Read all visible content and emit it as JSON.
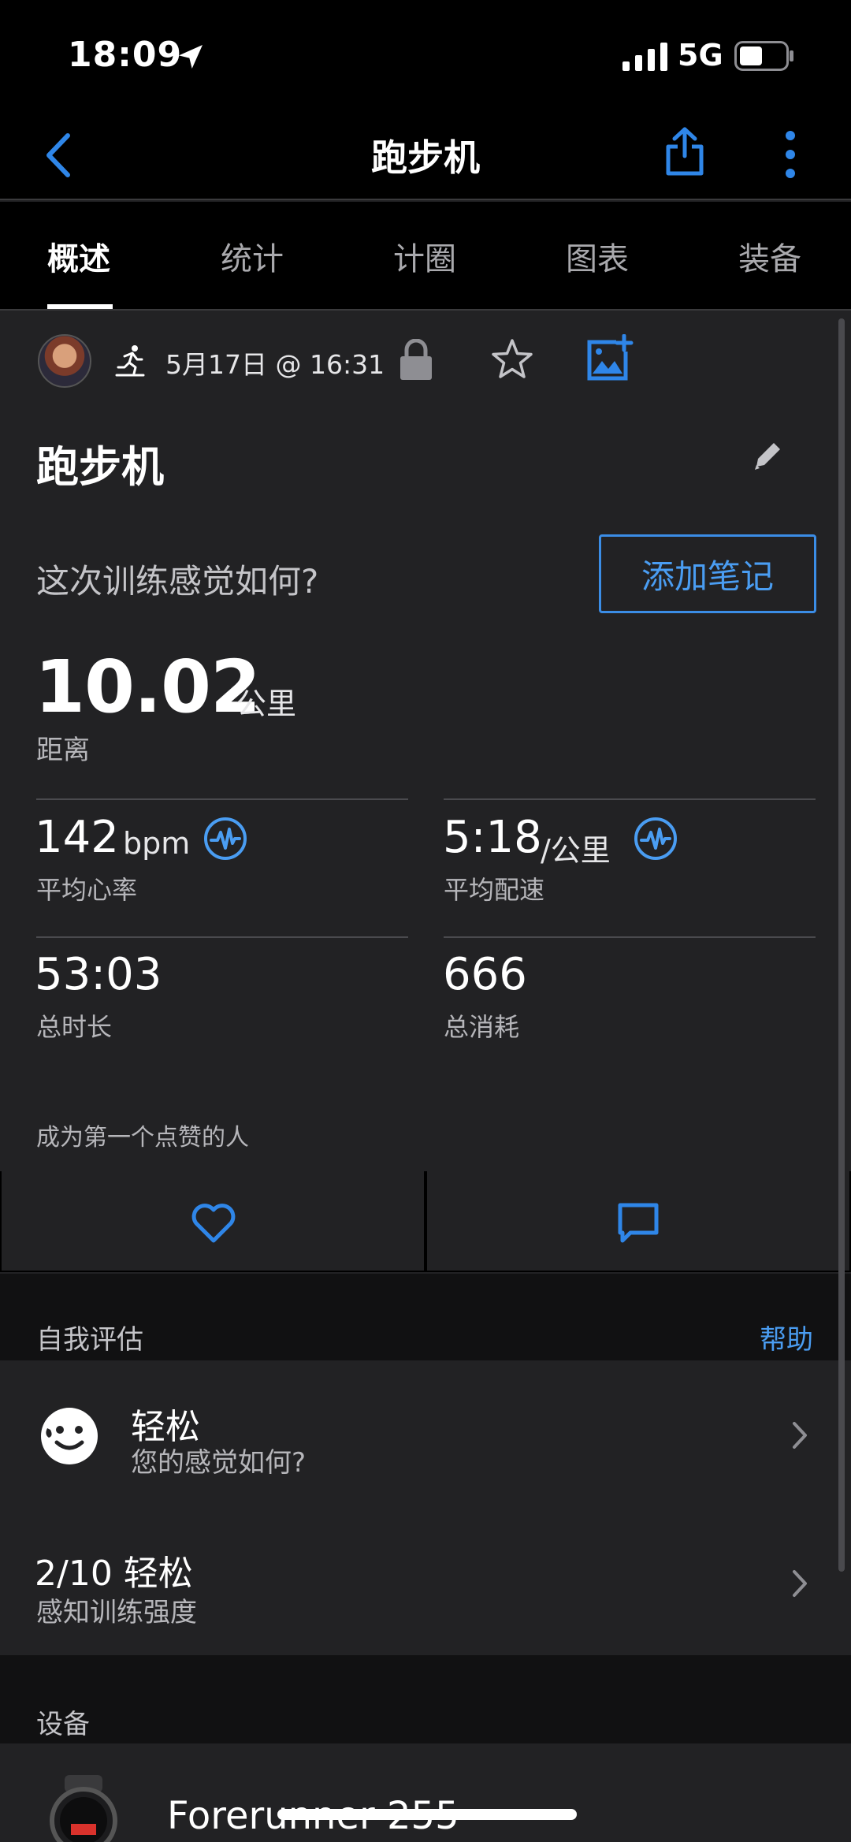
{
  "status_bar": {
    "time": "18:09",
    "network": "5G"
  },
  "nav": {
    "title": "跑步机"
  },
  "tabs": [
    {
      "label": "概述",
      "active": true
    },
    {
      "label": "统计",
      "active": false
    },
    {
      "label": "计圈",
      "active": false
    },
    {
      "label": "图表",
      "active": false
    },
    {
      "label": "装备",
      "active": false
    }
  ],
  "activity": {
    "date": "5月17日 @ 16:31",
    "title": "跑步机",
    "feel_question": "这次训练感觉如何?",
    "add_note_label": "添加笔记",
    "distance": {
      "value": "10.02",
      "unit": "公里",
      "label": "距离"
    },
    "metrics": {
      "avg_hr": {
        "value": "142",
        "unit": "bpm",
        "label": "平均心率"
      },
      "avg_pace": {
        "value": "5:18",
        "unit": "/公里",
        "label": "平均配速"
      },
      "total_time": {
        "value": "53:03",
        "label": "总时长"
      },
      "calories": {
        "value": "666",
        "label": "总消耗"
      }
    },
    "likes_text": "成为第一个点赞的人"
  },
  "self_eval": {
    "title": "自我评估",
    "help_label": "帮助",
    "feel": {
      "main": "轻松",
      "sub": "您的感觉如何?"
    },
    "rpe": {
      "main": "2/10 轻松",
      "sub": "感知训练强度"
    }
  },
  "devices": {
    "title": "设备",
    "name": "Forerunner 255"
  },
  "colors": {
    "accent": "#4a9df2",
    "background": "#222224",
    "bar": "#000000"
  }
}
